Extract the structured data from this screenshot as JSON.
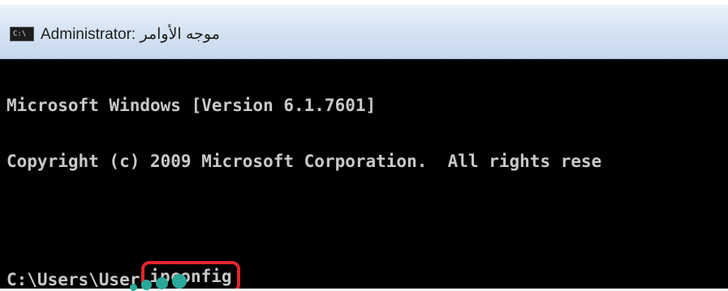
{
  "window": {
    "title": "Administrator: موجه الأوامر",
    "icon": "console-icon"
  },
  "console": {
    "lines": [
      "Microsoft Windows [Version 6.1.7601]",
      "Copyright (c) 2009 Microsoft Corporation.  All rights rese"
    ],
    "prompt": "C:\\Users\\User",
    "command": "ipconfig"
  },
  "colors": {
    "console_bg": "#000000",
    "console_text": "#c8c8c8",
    "highlight": "#e0252c",
    "dots": "#2aa89a"
  }
}
